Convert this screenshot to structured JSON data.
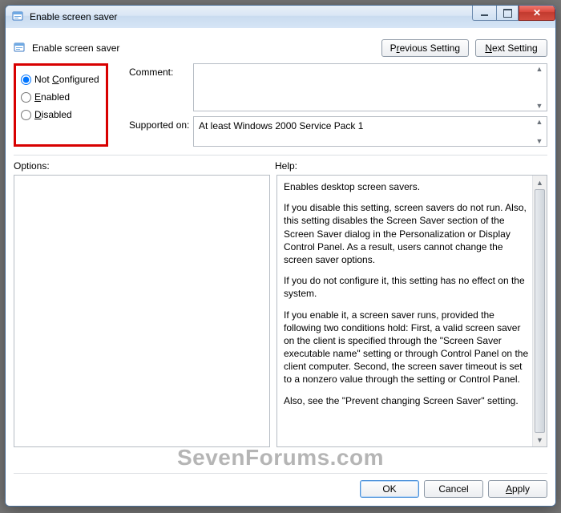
{
  "window": {
    "title": "Enable screen saver"
  },
  "header": {
    "title": "Enable screen saver",
    "prev_button_prefix": "P",
    "prev_button_hot": "r",
    "prev_button_suffix": "evious Setting",
    "next_button_prefix": "",
    "next_button_hot": "N",
    "next_button_suffix": "ext Setting"
  },
  "state_options": {
    "not_configured_prefix": "Not ",
    "not_configured_hot": "C",
    "not_configured_suffix": "onfigured",
    "enabled_hot": "E",
    "enabled_suffix": "nabled",
    "disabled_hot": "D",
    "disabled_suffix": "isabled",
    "selected": "not_configured"
  },
  "fields": {
    "comment_label": "Comment:",
    "comment_value": "",
    "supported_label": "Supported on:",
    "supported_value": "At least Windows 2000 Service Pack 1"
  },
  "panes": {
    "options_label": "Options:",
    "help_label": "Help:",
    "help_paragraphs": [
      "Enables desktop screen savers.",
      "If you disable this setting, screen savers do not run. Also, this setting disables the Screen Saver section of the Screen Saver dialog in the Personalization or Display Control Panel. As a result, users cannot change the screen saver options.",
      "If you do not configure it, this setting has no effect on the system.",
      "If you enable it, a screen saver runs, provided the following two conditions hold: First, a valid screen saver on the client is specified through the \"Screen Saver executable name\" setting or through Control Panel on the client computer. Second, the screen saver timeout is set to a nonzero value through the setting or Control Panel.",
      "Also, see the \"Prevent changing Screen Saver\" setting."
    ]
  },
  "footer": {
    "ok": "OK",
    "cancel": "Cancel",
    "apply_hot": "A",
    "apply_suffix": "pply"
  },
  "watermark": "SevenForums.com"
}
